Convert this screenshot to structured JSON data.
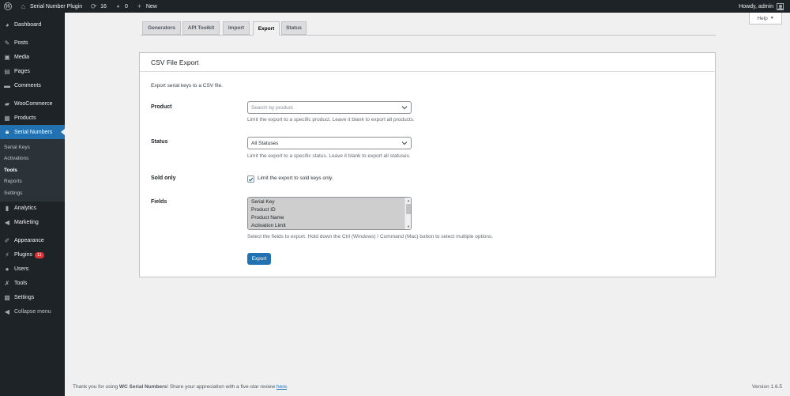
{
  "adminbar": {
    "site_name": "Serial Number Plugin",
    "updates_count": "16",
    "comments_count": "0",
    "new_label": "New",
    "greeting": "Howdy, admin"
  },
  "sidebar": {
    "items": [
      {
        "label": "Dashboard",
        "icon": "dashboard-icon"
      },
      {
        "label": "Posts",
        "icon": "pin-icon"
      },
      {
        "label": "Media",
        "icon": "media-icon"
      },
      {
        "label": "Pages",
        "icon": "page-icon"
      },
      {
        "label": "Comments",
        "icon": "comment-icon"
      },
      {
        "label": "WooCommerce",
        "icon": "woo-icon"
      },
      {
        "label": "Products",
        "icon": "product-icon"
      },
      {
        "label": "Serial Numbers",
        "icon": "lock-icon"
      },
      {
        "label": "Analytics",
        "icon": "bar-chart-icon"
      },
      {
        "label": "Marketing",
        "icon": "megaphone-icon"
      },
      {
        "label": "Appearance",
        "icon": "brush-icon"
      },
      {
        "label": "Plugins",
        "icon": "plug-icon",
        "badge": "11"
      },
      {
        "label": "Users",
        "icon": "user-icon"
      },
      {
        "label": "Tools",
        "icon": "wrench-icon"
      },
      {
        "label": "Settings",
        "icon": "settings-icon"
      },
      {
        "label": "Collapse menu",
        "icon": "collapse-icon"
      }
    ],
    "submenu": [
      "Serial Keys",
      "Activations",
      "Tools",
      "Reports",
      "Settings"
    ]
  },
  "help_tab": "Help",
  "tabs": [
    "Generators",
    "API Toolkit",
    "Import",
    "Export",
    "Status"
  ],
  "panel": {
    "title": "CSV File Export",
    "description": "Export serial keys to a CSV file.",
    "product": {
      "label": "Product",
      "placeholder": "Search by product",
      "help": "Limit the export to a specific product. Leave it blank to export all products."
    },
    "status": {
      "label": "Status",
      "value": "All Statuses",
      "help": "Limit the export to a specific status. Leave it blank to export all statuses."
    },
    "sold_only": {
      "label": "Sold only",
      "checkbox_label": "Limit the export to sold keys only.",
      "checked": true
    },
    "fields": {
      "label": "Fields",
      "options": [
        "Serial Key",
        "Product ID",
        "Product Name",
        "Activation Limit"
      ],
      "help": "Select the fields to export. Hold down the Ctrl (Windows) / Command (Mac) button to select multiple options."
    },
    "export_button": "Export"
  },
  "footer": {
    "text_before": "Thank you for using ",
    "plugin_name": "WC Serial Numbers",
    "text_after": "! Share your appreciation with a five-star review ",
    "link": "here",
    "text_end": ".",
    "version": "Version 1.6.5"
  }
}
